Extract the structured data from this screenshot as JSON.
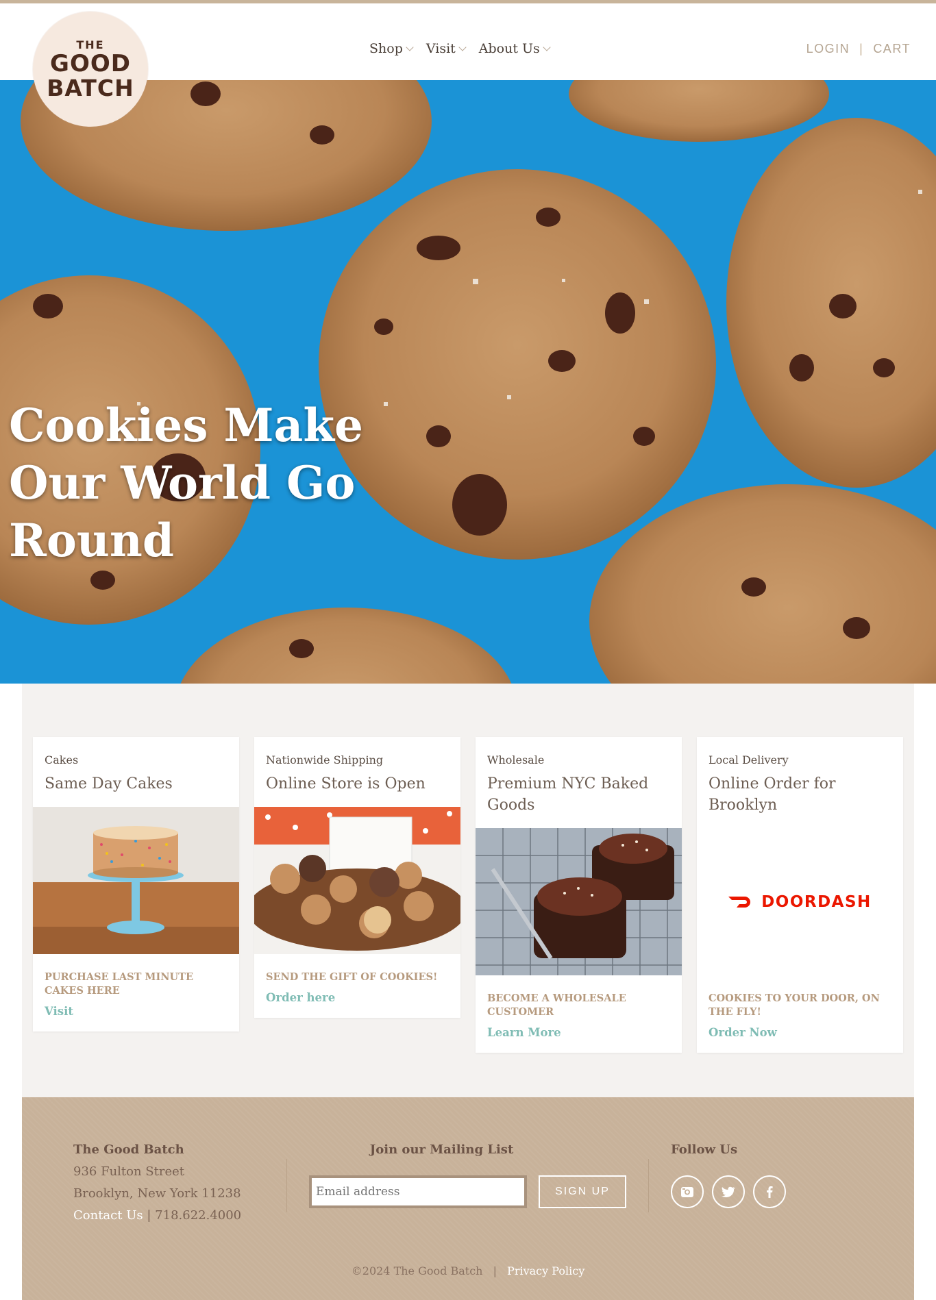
{
  "brand": {
    "logo_the": "THE",
    "logo_good": "GOOD",
    "logo_batch": "BATCH"
  },
  "nav": {
    "items": [
      {
        "label": "Shop"
      },
      {
        "label": "Visit"
      },
      {
        "label": "About Us"
      }
    ]
  },
  "account": {
    "login": "LOGIN",
    "separator": "|",
    "cart": "CART"
  },
  "hero": {
    "title": "Cookies Make Our World Go Round"
  },
  "cards": [
    {
      "category": "Cakes",
      "title": "Same Day Cakes",
      "cta": "PURCHASE LAST MINUTE CAKES HERE",
      "link": "Visit"
    },
    {
      "category": "Nationwide Shipping",
      "title": "Online Store is Open",
      "cta": "SEND THE GIFT OF COOKIES!",
      "link": "Order here"
    },
    {
      "category": "Wholesale",
      "title": "Premium NYC Baked Goods",
      "cta": "BECOME A WHOLESALE CUSTOMER",
      "link": "Learn More"
    },
    {
      "category": "Local Delivery",
      "title": "Online Order for Brooklyn",
      "cta": "COOKIES TO YOUR DOOR, ON THE FLY!",
      "link": "Order Now",
      "partner_logo": "DOORDASH"
    }
  ],
  "footer": {
    "store_name": "The Good Batch",
    "address_line1": "936 Fulton Street",
    "address_line2": "Brooklyn, New York 11238",
    "contact_link": "Contact Us",
    "contact_separator": "|",
    "phone": "718.622.4000",
    "mailing_heading": "Join our Mailing List",
    "email_placeholder": "Email address",
    "signup_label": "SIGN UP",
    "follow_heading": "Follow Us",
    "social_icons": [
      "instagram-icon",
      "twitter-icon",
      "facebook-icon"
    ],
    "copyright": "©2024 The Good Batch",
    "copyright_separator": "|",
    "privacy_link": "Privacy Policy"
  },
  "colors": {
    "accent_tan": "#c8b29a",
    "link_teal": "#7fbcb4",
    "hero_blue": "#1b93d6",
    "doordash_red": "#eb1700"
  }
}
